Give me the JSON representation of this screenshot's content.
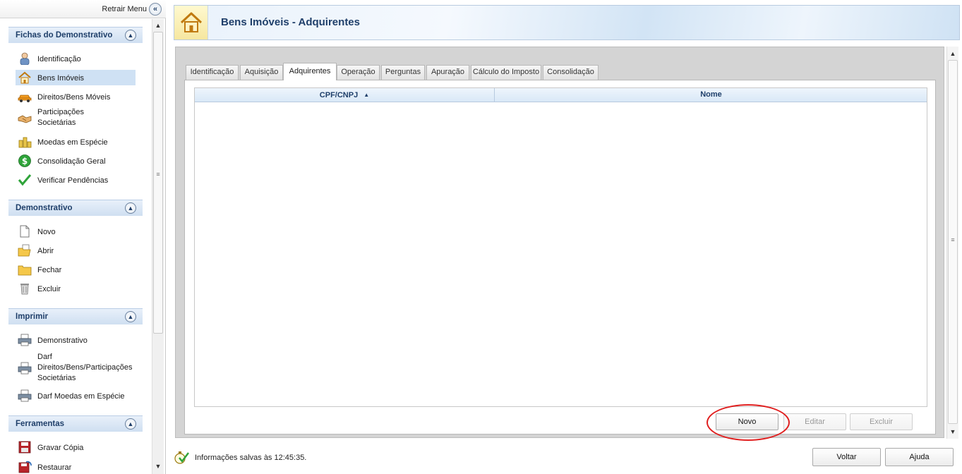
{
  "left_menu": {
    "collapse_label": "Retrair Menu",
    "sections": [
      {
        "title": "Fichas do Demonstrativo",
        "items": [
          {
            "label": "Identificação",
            "icon": "person-icon",
            "selected": false
          },
          {
            "label": "Bens Imóveis",
            "icon": "house-icon",
            "selected": true
          },
          {
            "label": "Direitos/Bens Móveis",
            "icon": "car-icon",
            "selected": false
          },
          {
            "label": "Participações\nSocietárias",
            "icon": "handshake-icon",
            "selected": false
          },
          {
            "label": "Moedas em Espécie",
            "icon": "coins-icon",
            "selected": false
          },
          {
            "label": "Consolidação Geral",
            "icon": "dollar-icon",
            "selected": false
          },
          {
            "label": "Verificar Pendências",
            "icon": "check-icon",
            "selected": false
          }
        ]
      },
      {
        "title": "Demonstrativo",
        "items": [
          {
            "label": "Novo",
            "icon": "new-document-icon"
          },
          {
            "label": "Abrir",
            "icon": "open-folder-icon"
          },
          {
            "label": "Fechar",
            "icon": "folder-icon"
          },
          {
            "label": "Excluir",
            "icon": "trash-icon"
          }
        ]
      },
      {
        "title": "Imprimir",
        "items": [
          {
            "label": "Demonstrativo",
            "icon": "printer-icon"
          },
          {
            "label": "Darf\nDireitos/Bens/Participações\nSocietárias",
            "icon": "printer-icon"
          },
          {
            "label": "Darf Moedas em Espécie",
            "icon": "printer-icon"
          }
        ]
      },
      {
        "title": "Ferramentas",
        "items": [
          {
            "label": "Gravar Cópia",
            "icon": "floppy-disk-icon"
          },
          {
            "label": "Restaurar",
            "icon": "restore-icon"
          }
        ]
      }
    ]
  },
  "header": {
    "title": "Bens Imóveis - Adquirentes",
    "icon": "house-icon"
  },
  "tabs": [
    "Identificação",
    "Aquisição",
    "Adquirentes",
    "Operação",
    "Perguntas",
    "Apuração",
    "Cálculo do Imposto",
    "Consolidação"
  ],
  "active_tab": "Adquirentes",
  "table": {
    "columns": [
      "CPF/CNPJ",
      "Nome"
    ],
    "sort_column": "CPF/CNPJ",
    "sort_direction": "ascending",
    "rows": []
  },
  "actions": {
    "novo": "Novo",
    "editar": "Editar",
    "excluir": "Excluir"
  },
  "footer": {
    "status": "Informações salvas às 12:45:35.",
    "voltar": "Voltar",
    "ajuda": "Ajuda"
  },
  "colors": {
    "header_text": "#1f3f6a",
    "section_header": "#cfdff1",
    "selected_item": "#cfe1f4",
    "highlight_ring": "#e02020"
  }
}
